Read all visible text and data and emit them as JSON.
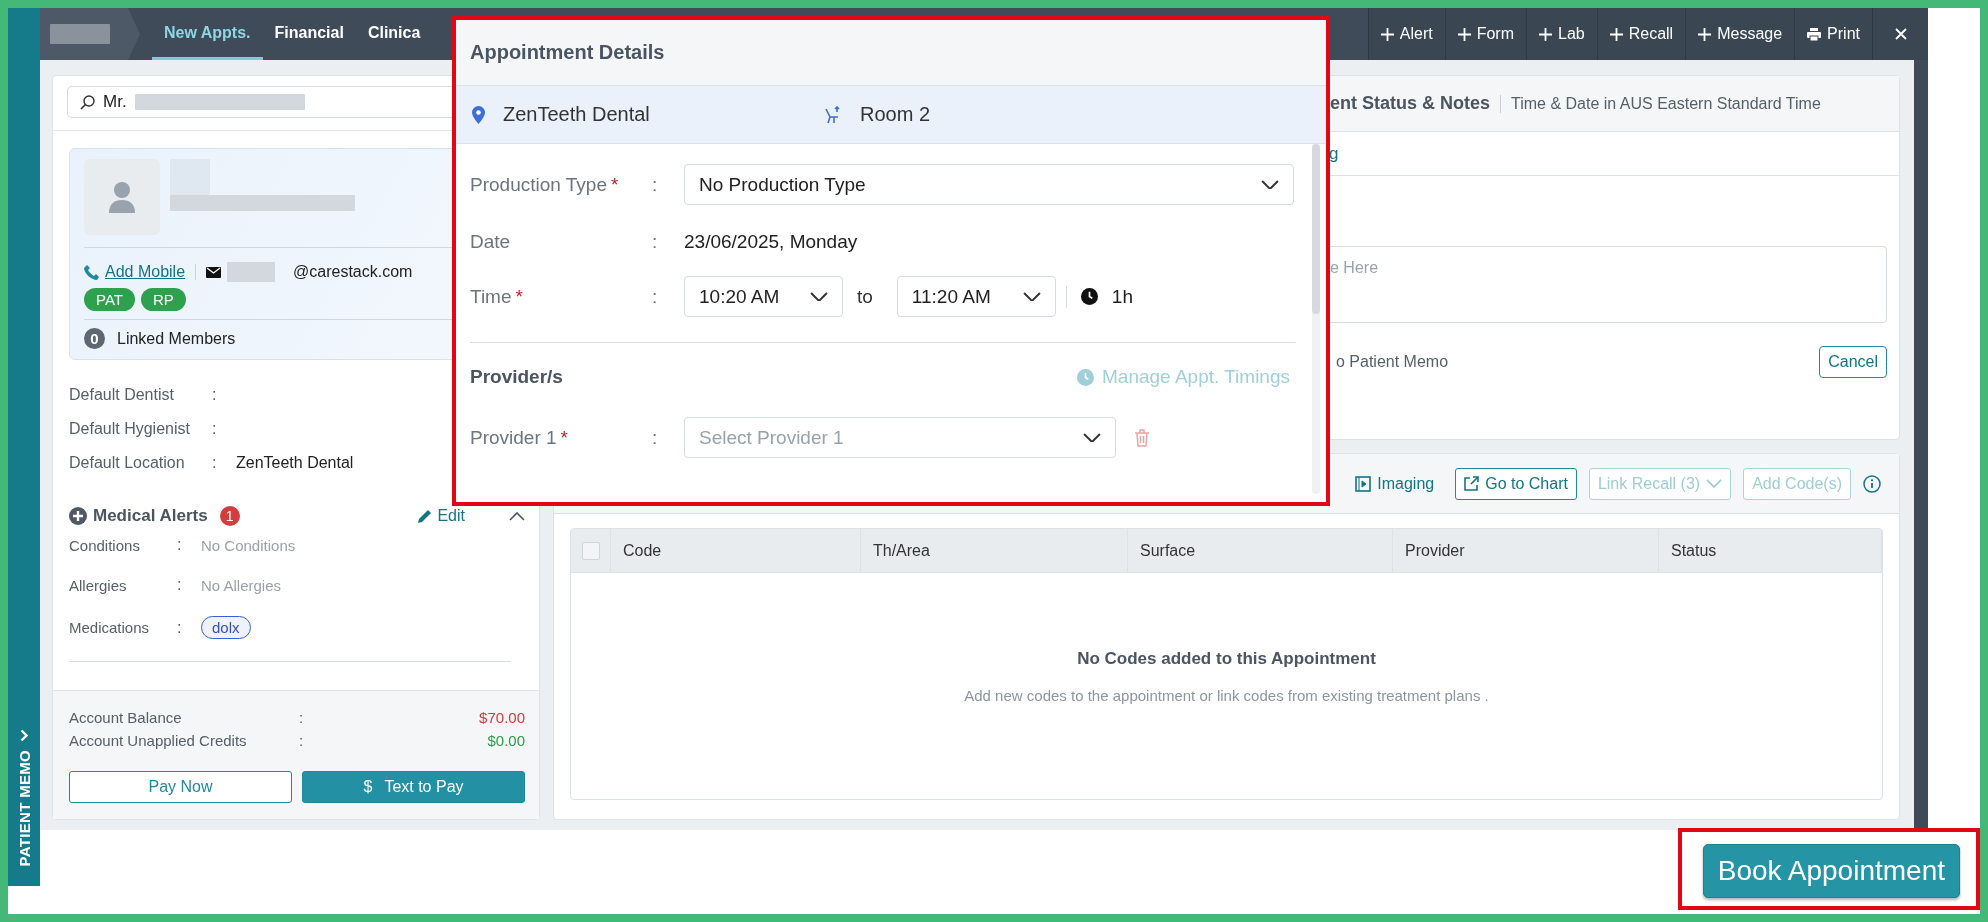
{
  "top_nav": {
    "tabs": [
      {
        "label": "New Appts.",
        "selected": true
      },
      {
        "label": "Financial",
        "selected": false
      },
      {
        "label": "Clinica",
        "selected": false
      }
    ],
    "actions": [
      {
        "label": "Alert",
        "kind": "add"
      },
      {
        "label": "Form",
        "kind": "add"
      },
      {
        "label": "Lab",
        "kind": "add"
      },
      {
        "label": "Recall",
        "kind": "add"
      },
      {
        "label": "Message",
        "kind": "add"
      },
      {
        "label": "Print",
        "kind": "print"
      }
    ]
  },
  "side_tab": {
    "label": "PATIENT MEMO"
  },
  "marks": {
    "separator": ":",
    "required": "*"
  },
  "patient": {
    "search_value": "Mr.",
    "add_mobile": "Add Mobile",
    "email_domain": "@carestack.com",
    "tags": [
      {
        "label": "PAT"
      },
      {
        "label": "RP"
      }
    ],
    "linked_count": "0",
    "linked_label": "Linked Members",
    "defaults": [
      {
        "label": "Default Dentist"
      },
      {
        "label": "Default Hygienist"
      },
      {
        "label": "Default Location",
        "value": "ZenTeeth Dental"
      }
    ]
  },
  "medical_alerts": {
    "title": "Medical Alerts",
    "count": "1",
    "edit": "Edit",
    "expanded": true,
    "rows": [
      {
        "label": "Conditions",
        "value": "No Conditions",
        "kind": "text"
      },
      {
        "label": "Allergies",
        "value": "No Allergies",
        "kind": "text"
      },
      {
        "label": "Medications",
        "value": "dolx",
        "kind": "pill"
      }
    ]
  },
  "account": {
    "rows": [
      {
        "label": "Account Balance",
        "value": "$70.00",
        "color": "#d43b3b"
      },
      {
        "label": "Account Unapplied Credits",
        "value": "$0.00",
        "color": "#2a9d48"
      }
    ],
    "buttons": [
      {
        "label": "Pay Now",
        "kind": "outline"
      },
      {
        "label": "Text to Pay",
        "kind": "primary",
        "glyph": "$"
      }
    ]
  },
  "status_notes": {
    "title": "ent Status & Notes",
    "subtitle": "Time & Date in AUS Eastern Standard Time",
    "row_text": "g",
    "note_placeholder": "e Here",
    "memo_label": "o Patient Memo",
    "cancel": "Cancel"
  },
  "codes_toolbar": [
    {
      "label": "Imaging",
      "kind": "link",
      "disabled": false
    },
    {
      "label": "Go to Chart",
      "kind": "outline",
      "disabled": false
    },
    {
      "label": "Link Recall (3)",
      "kind": "dropdown",
      "disabled": true
    },
    {
      "label": "Add Code(s)",
      "kind": "outline",
      "disabled": true
    }
  ],
  "codes_table": {
    "select_all_checked": false,
    "columns": [
      "Code",
      "Th/Area",
      "Surface",
      "Provider",
      "Status"
    ],
    "empty_title": "No Codes added to this Appointment",
    "empty_text": "Add new codes to the appointment or link codes from existing treatment plans ."
  },
  "appointment_details": {
    "title": "Appointment Details",
    "location": "ZenTeeth Dental",
    "room": "Room 2",
    "production_type": {
      "label": "Production Type",
      "required": true,
      "value": "No Production Type"
    },
    "date": {
      "label": "Date",
      "value": "23/06/2025, Monday"
    },
    "time": {
      "label": "Time",
      "required": true,
      "start": "10:20 AM",
      "joiner": "to",
      "end": "11:20 AM",
      "duration": "1h"
    },
    "providers": {
      "title": "Provider/s",
      "manage": "Manage Appt. Timings",
      "manage_disabled": true,
      "rows": [
        {
          "label": "Provider 1",
          "required": true,
          "placeholder": "Select Provider 1"
        }
      ]
    }
  },
  "book_button": {
    "label": "Book Appointment"
  }
}
